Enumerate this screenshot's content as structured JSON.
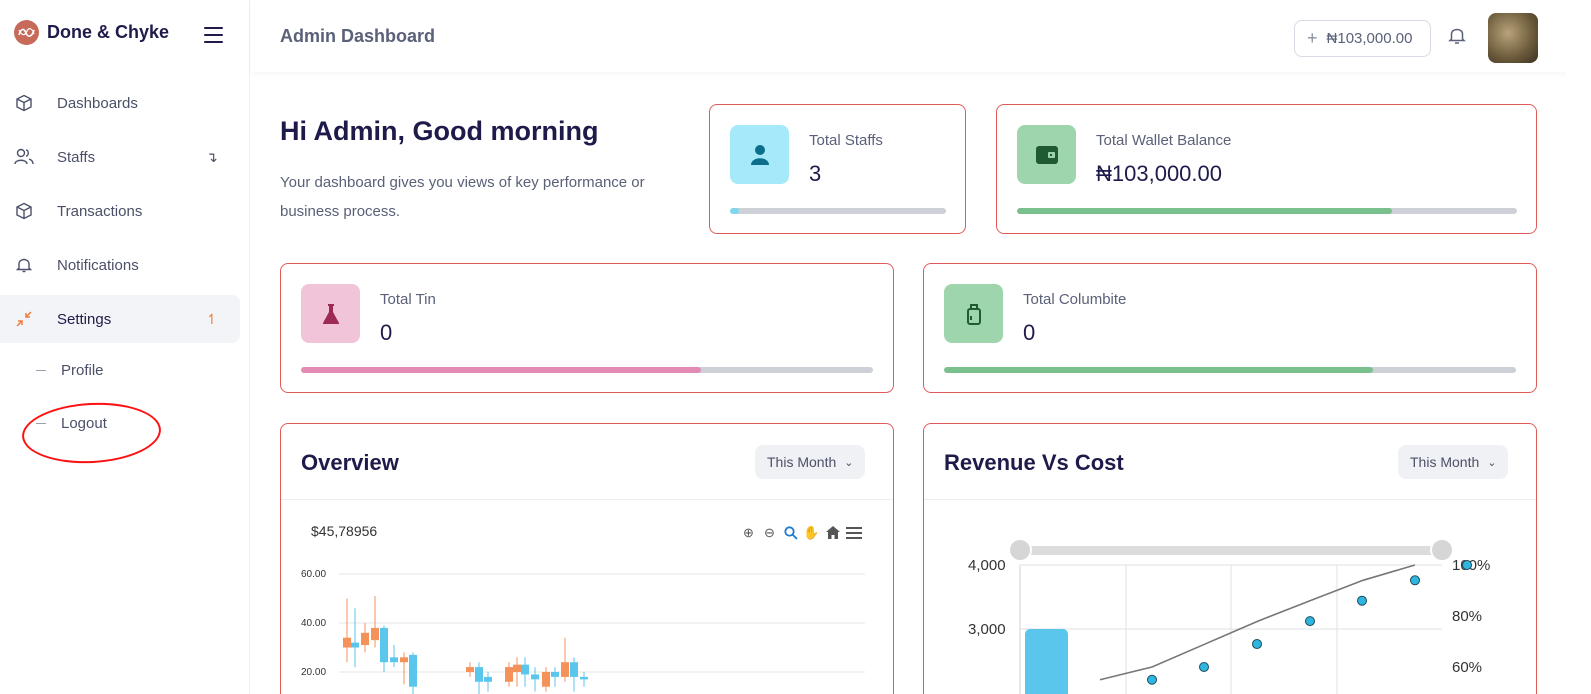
{
  "brand": {
    "name": "Done & Chyke"
  },
  "sidebar": {
    "items": [
      {
        "label": "Dashboards",
        "icon": "cube-icon"
      },
      {
        "label": "Staffs",
        "icon": "users-icon",
        "caret": "↴"
      },
      {
        "label": "Transactions",
        "icon": "cube-icon"
      },
      {
        "label": "Notifications",
        "icon": "bell-icon"
      },
      {
        "label": "Settings",
        "icon": "collapse-icon",
        "caret": "↿"
      }
    ],
    "sub_items": [
      {
        "label": "Profile"
      },
      {
        "label": "Logout"
      }
    ]
  },
  "header": {
    "title": "Admin Dashboard",
    "wallet_button": "₦103,000.00"
  },
  "greeting": {
    "title": "Hi Admin, Good morning",
    "subtitle": "Your dashboard gives you views of key performance or business process."
  },
  "stats": [
    {
      "label": "Total Staffs",
      "value": "3",
      "icon_bg": "#a5e9fb",
      "icon_color": "#0b6e8a",
      "progress": 0.04,
      "bar_color": "#7fd6ee"
    },
    {
      "label": "Total Wallet Balance",
      "value": "₦103,000.00",
      "icon_bg": "#9fd5ad",
      "icon_color": "#1f5a33",
      "progress": 0.75,
      "bar_color": "#7ac08c"
    },
    {
      "label": "Total Tin",
      "value": "0",
      "icon_bg": "#f2c4d9",
      "icon_color": "#9c2a54",
      "progress": 0.7,
      "bar_color": "#e48bb4"
    },
    {
      "label": "Total Columbite",
      "value": "0",
      "icon_bg": "#9fd5ad",
      "icon_color": "#1f5a33",
      "progress": 0.75,
      "bar_color": "#7ac08c"
    }
  ],
  "overview": {
    "title": "Overview",
    "period": "This Month",
    "price_label": "$45,78956",
    "chart_data": {
      "type": "candlestick",
      "y_ticks": [
        "60.00",
        "40.00",
        "20.00"
      ],
      "ylim": [
        0,
        60
      ],
      "candles": [
        {
          "o": 30,
          "c": 34,
          "h": 50,
          "l": 24,
          "color": "#f5925a"
        },
        {
          "o": 30,
          "c": 32,
          "h": 46,
          "l": 22,
          "color": "#5bc6ec"
        },
        {
          "o": 31,
          "c": 36,
          "h": 40,
          "l": 28,
          "color": "#f5925a"
        },
        {
          "o": 33,
          "c": 38,
          "h": 51,
          "l": 30,
          "color": "#f5925a"
        },
        {
          "o": 38,
          "c": 24,
          "h": 39,
          "l": 20,
          "color": "#5bc6ec"
        },
        {
          "o": 24,
          "c": 26,
          "h": 31,
          "l": 22,
          "color": "#5bc6ec"
        },
        {
          "o": 24,
          "c": 26,
          "h": 28,
          "l": 15,
          "color": "#f5925a"
        },
        {
          "o": 27,
          "c": 14,
          "h": 28,
          "l": 10,
          "color": "#5bc6ec"
        },
        {
          "o": 20,
          "c": 22,
          "h": 24,
          "l": 18,
          "color": "#f5925a"
        },
        {
          "o": 22,
          "c": 16,
          "h": 24,
          "l": 10,
          "color": "#5bc6ec"
        },
        {
          "o": 18,
          "c": 16,
          "h": 20,
          "l": 12,
          "color": "#5bc6ec"
        },
        {
          "o": 16,
          "c": 22,
          "h": 24,
          "l": 14,
          "color": "#f5925a"
        },
        {
          "o": 20,
          "c": 23,
          "h": 26,
          "l": 14,
          "color": "#f5925a"
        },
        {
          "o": 23,
          "c": 19,
          "h": 26,
          "l": 14,
          "color": "#5bc6ec"
        },
        {
          "o": 19,
          "c": 17,
          "h": 22,
          "l": 12,
          "color": "#5bc6ec"
        },
        {
          "o": 14,
          "c": 20,
          "h": 22,
          "l": 12,
          "color": "#f5925a"
        },
        {
          "o": 20,
          "c": 18,
          "h": 22,
          "l": 14,
          "color": "#5bc6ec"
        },
        {
          "o": 18,
          "c": 24,
          "h": 34,
          "l": 16,
          "color": "#f5925a"
        },
        {
          "o": 24,
          "c": 18,
          "h": 26,
          "l": 12,
          "color": "#5bc6ec"
        },
        {
          "o": 18,
          "c": 17,
          "h": 20,
          "l": 14,
          "color": "#5bc6ec"
        }
      ]
    }
  },
  "revenue": {
    "title": "Revenue Vs Cost",
    "period": "This Month",
    "chart_data": {
      "type": "bar+line",
      "left_ticks": [
        "4,000",
        "3,000"
      ],
      "right_ticks": [
        "100%",
        "80%",
        "60%"
      ],
      "bars": [
        3000
      ],
      "line_percent": [
        55,
        60,
        69,
        78,
        86,
        94,
        100
      ]
    }
  },
  "colors": {
    "accent": "#f07d3a",
    "navy": "#1e1b4b",
    "card_border": "#e15a5a",
    "annotation": "#ff1010"
  }
}
